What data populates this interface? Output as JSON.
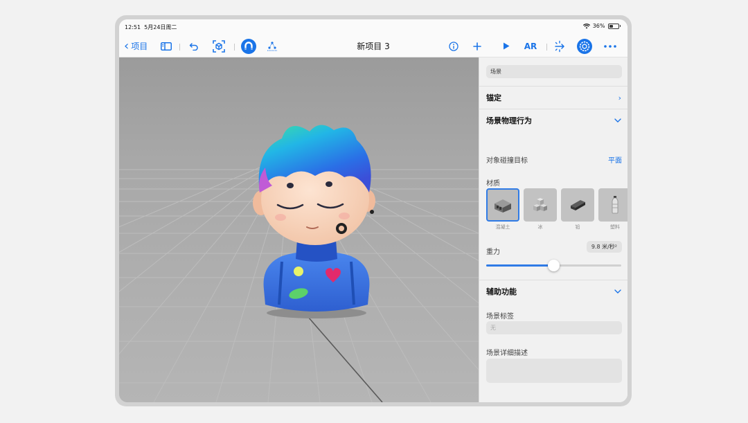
{
  "status_bar": {
    "time": "12:51",
    "date": "5月24日周二",
    "battery": "36%"
  },
  "toolbar": {
    "back_label": "项目",
    "title": "新项目 3",
    "ar_label": "AR"
  },
  "panel": {
    "scene_field": "场景",
    "anchor_label": "锚定",
    "physics_label": "场景物理行为",
    "collision_label": "对象碰撞目标",
    "collision_value": "平面",
    "material_label": "材质",
    "materials": [
      {
        "label": "混凝土"
      },
      {
        "label": "冰"
      },
      {
        "label": "铅"
      },
      {
        "label": "塑料"
      }
    ],
    "gravity_label": "重力",
    "gravity_value": "9.8 米/秒²",
    "gravity_slider_fraction": 0.5,
    "accessibility_label": "辅助功能",
    "scene_tag_label": "场景标签",
    "scene_tag_placeholder": "无",
    "scene_desc_label": "场景详细描述"
  },
  "colors": {
    "accent": "#1a74e8",
    "viewport_bg": "#a7a7a7",
    "panel_bg": "#f1f1f1"
  }
}
